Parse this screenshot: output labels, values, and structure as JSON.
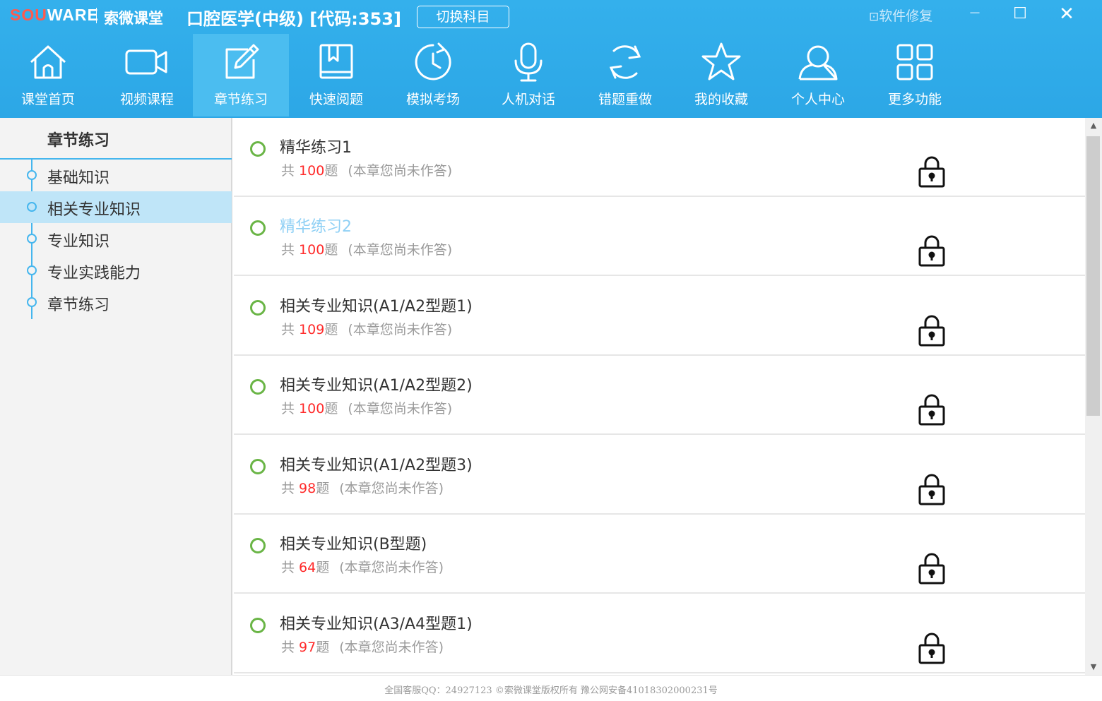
{
  "titlebar": {
    "logo_sou": "SOU",
    "logo_ware": "WARE",
    "brand": "索微课堂",
    "subject": "口腔医学(中级) [代码:353]",
    "switch_label": "切换科目",
    "repair_icon": "⊡",
    "repair_label": "软件修复",
    "minimize": "－",
    "maximize": "☐",
    "close": "✕"
  },
  "nav": [
    {
      "label": "课堂首页",
      "icon": "home-icon"
    },
    {
      "label": "视频课程",
      "icon": "video-camera-icon"
    },
    {
      "label": "章节练习",
      "icon": "edit-note-icon",
      "active": true
    },
    {
      "label": "快速阅题",
      "icon": "book-icon"
    },
    {
      "label": "模拟考场",
      "icon": "clock-icon"
    },
    {
      "label": "人机对话",
      "icon": "microphone-icon"
    },
    {
      "label": "错题重做",
      "icon": "refresh-icon"
    },
    {
      "label": "我的收藏",
      "icon": "star-icon"
    },
    {
      "label": "个人中心",
      "icon": "user-icon"
    },
    {
      "label": "更多功能",
      "icon": "grid-icon"
    }
  ],
  "sidebar": {
    "title": "章节练习",
    "items": [
      {
        "label": "基础知识"
      },
      {
        "label": "相关专业知识",
        "active": true
      },
      {
        "label": "专业知识"
      },
      {
        "label": "专业实践能力"
      },
      {
        "label": "章节练习"
      }
    ]
  },
  "list": [
    {
      "title": "精华练习1",
      "prefix": "共 ",
      "count": "100",
      "suffix": "题",
      "status": "(本章您尚未作答)"
    },
    {
      "title": "精华练习2",
      "prefix": "共 ",
      "count": "100",
      "suffix": "题",
      "status": "(本章您尚未作答)",
      "highlight": true
    },
    {
      "title": "相关专业知识(A1/A2型题1)",
      "prefix": "共 ",
      "count": "109",
      "suffix": "题",
      "status": "(本章您尚未作答)"
    },
    {
      "title": "相关专业知识(A1/A2型题2)",
      "prefix": "共 ",
      "count": "100",
      "suffix": "题",
      "status": "(本章您尚未作答)"
    },
    {
      "title": "相关专业知识(A1/A2型题3)",
      "prefix": "共 ",
      "count": "98",
      "suffix": "题",
      "status": "(本章您尚未作答)"
    },
    {
      "title": "相关专业知识(B型题)",
      "prefix": "共 ",
      "count": "64",
      "suffix": "题",
      "status": "(本章您尚未作答)"
    },
    {
      "title": "相关专业知识(A3/A4型题1)",
      "prefix": "共 ",
      "count": "97",
      "suffix": "题",
      "status": "(本章您尚未作答)"
    }
  ],
  "scrollbar": {
    "up": "▲",
    "down": "▼"
  },
  "footer": {
    "text": "全国客服QQ：24927123 ©索微课堂版权所有 豫公网安备41018302000231号"
  },
  "colors": {
    "header_blue": "#2ca7e6",
    "count_red": "#ff2a2a",
    "circle_green": "#6ab546",
    "sidebar_active": "#bfe5f8"
  }
}
